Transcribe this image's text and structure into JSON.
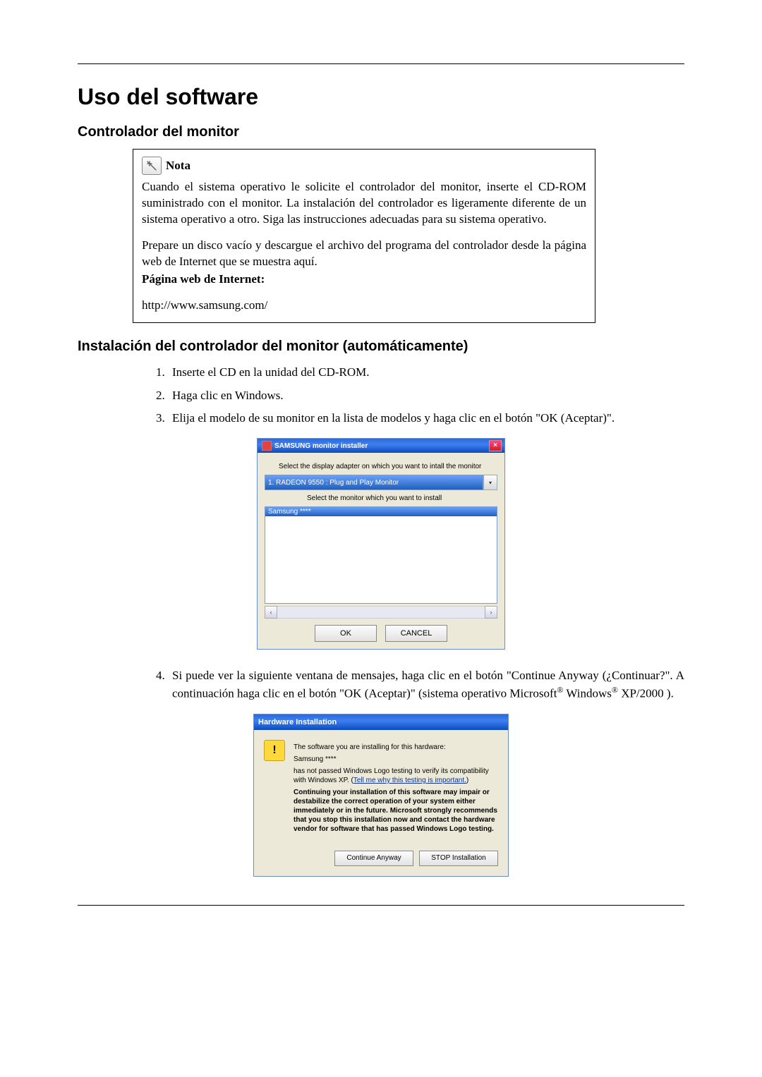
{
  "page": {
    "title": "Uso del software",
    "section1": "Controlador del monitor",
    "section2": "Instalación del controlador del monitor (automáticamente)"
  },
  "note": {
    "label": "Nota",
    "p1": "Cuando el sistema operativo le solicite el controlador del monitor, inserte el CD-ROM suministrado con el monitor. La instalación del controlador es ligeramente diferente de un sistema operativo a otro. Siga las instrucciones adecuadas para su sistema operativo.",
    "p2": "Prepare un disco vacío y descargue el archivo del programa del controlador desde la página web de Internet que se muestra aquí.",
    "weblabel": "Página web de Internet:",
    "url": "http://www.samsung.com/"
  },
  "steps": {
    "s1": "Inserte el CD en la unidad del CD-ROM.",
    "s2": "Haga clic en Windows.",
    "s3": "Elija el modelo de su monitor en la lista de modelos y haga clic en el botón \"OK (Aceptar)\".",
    "s4a": "Si puede ver la siguiente ventana de mensajes, haga clic en el botón \"Continue Anyway (¿Continuar?\". A continuación haga clic en el botón \"OK (Aceptar)\" (sistema operativo Microsoft",
    "s4b": " Windows",
    "s4c": " XP/2000 )."
  },
  "installer": {
    "title": "SAMSUNG monitor installer",
    "prompt1": "Select the display adapter on which you want to intall the monitor",
    "adapter": "1. RADEON 9550 : Plug and Play Monitor",
    "prompt2": "Select the monitor which you want to install",
    "selected_model": "Samsung ****",
    "ok": "OK",
    "cancel": "CANCEL"
  },
  "hw": {
    "title": "Hardware Installation",
    "line1": "The software you are installing for this hardware:",
    "device": "Samsung ****",
    "line2a": "has not passed Windows Logo testing to verify its compatibility with Windows XP. (",
    "link": "Tell me why this testing is important.",
    "line2b": ")",
    "bold": "Continuing your installation of this software may impair or destabilize the correct operation of your system either immediately or in the future. Microsoft strongly recommends that you stop this installation now and contact the hardware vendor for software that has passed Windows Logo testing.",
    "continue": "Continue Anyway",
    "stop": "STOP Installation"
  }
}
